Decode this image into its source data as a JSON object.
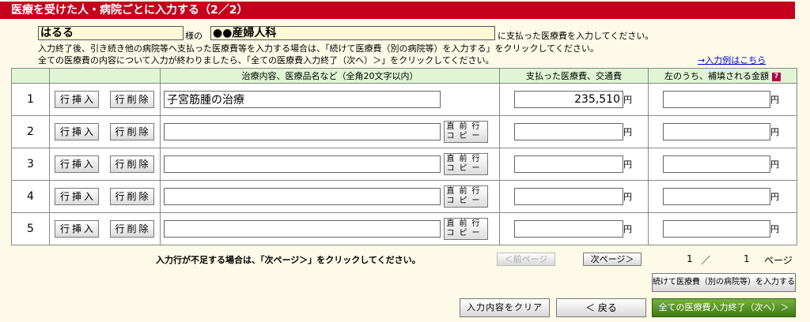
{
  "title": "医療を受けた人・病院ごとに入力する（2／2）",
  "patient_name": "はるる",
  "sama": "様の",
  "hospital_name": "●●産婦人科",
  "paid_text": "に支払った医療費を入力してください。",
  "instruction_1": "入力終了後、引き続き他の病院等へ支払った医療費等を入力する場合は、「続けて医療費（別の病院等）を入力する」をクリックしてください。",
  "instruction_2": "全ての医療費の内容について入力が終わりましたら、「全ての医療費入力終了（次へ）＞」をクリックしてください。",
  "example_link": "→入力例はこちら",
  "table": {
    "col_treatment": "治療内容、医療品名など（全角20文字以内）",
    "col_paid": "支払った医療費、交通費",
    "col_covered": "左のうち、補填される金額",
    "help_icon": "?",
    "insert_label": "行挿入",
    "delete_label": "行削除",
    "copy_label_top": "直前行",
    "copy_label_bottom": "コピー",
    "yen": "円",
    "rows": [
      {
        "num": "1",
        "treatment": "子宮筋腫の治療",
        "paid": "235,510",
        "covered": ""
      },
      {
        "num": "2",
        "treatment": "",
        "paid": "",
        "covered": ""
      },
      {
        "num": "3",
        "treatment": "",
        "paid": "",
        "covered": ""
      },
      {
        "num": "4",
        "treatment": "",
        "paid": "",
        "covered": ""
      },
      {
        "num": "5",
        "treatment": "",
        "paid": "",
        "covered": ""
      }
    ]
  },
  "pager": {
    "note": "入力行が不足する場合は、「次ページ＞」をクリックしてください。",
    "prev": "＜前ページ",
    "next": "次ページ＞",
    "current": "1",
    "sep": "／",
    "total": "1",
    "unit": "ページ"
  },
  "buttons": {
    "continue": "続けて医療費（別の病院等）を入力する",
    "clear": "入力内容をクリア",
    "back": "＜ 戻る",
    "finish": "全ての医療費入力終了（次へ）＞"
  }
}
